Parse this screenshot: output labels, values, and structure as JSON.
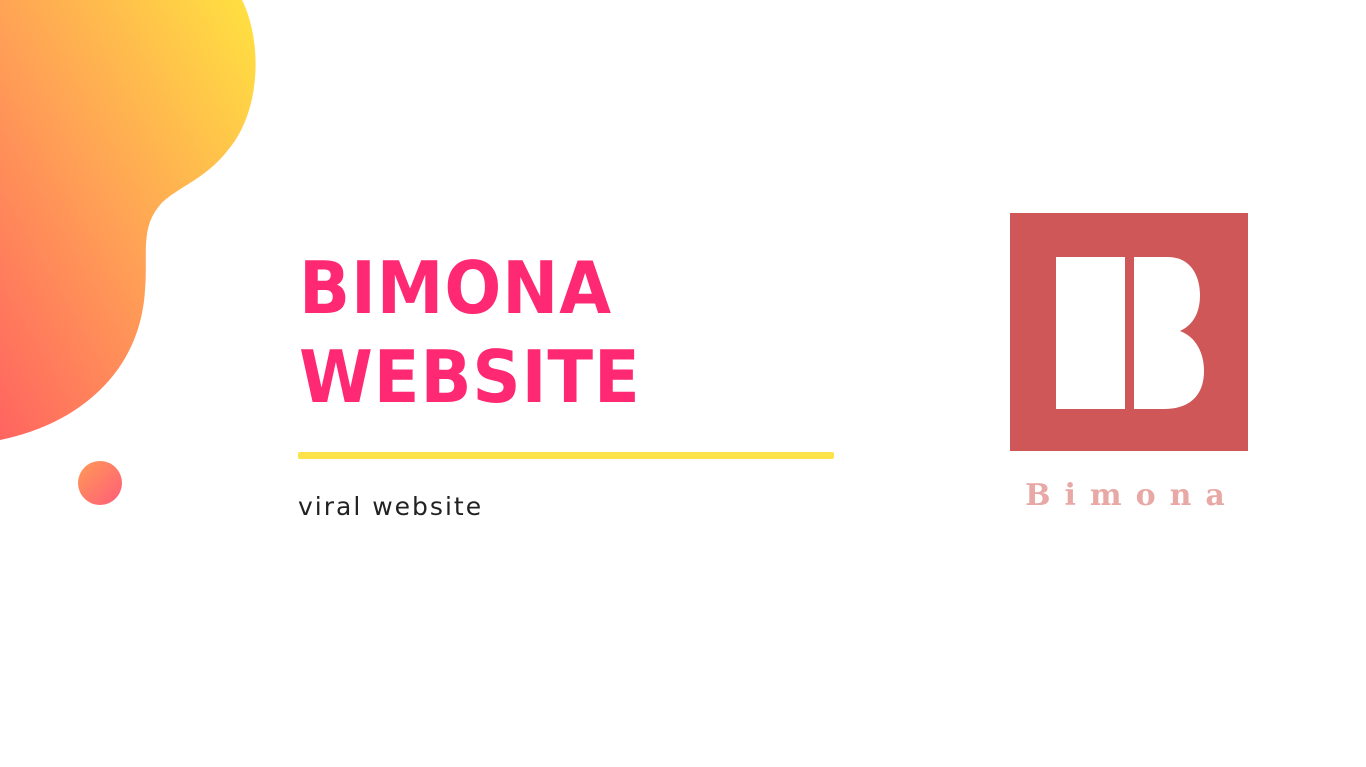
{
  "hero": {
    "title_line1": "BIMONA",
    "title_line2": "WEBSITE",
    "subtitle": "viral website"
  },
  "logo": {
    "wordmark": "Bimona",
    "initial": "B"
  },
  "colors": {
    "title": "#ff2872",
    "divider": "#fde34a",
    "logo_box": "#d05757",
    "logo_wordmark": "#e8a8a5",
    "blob_start": "#ffe240",
    "blob_end": "#ff6460"
  }
}
